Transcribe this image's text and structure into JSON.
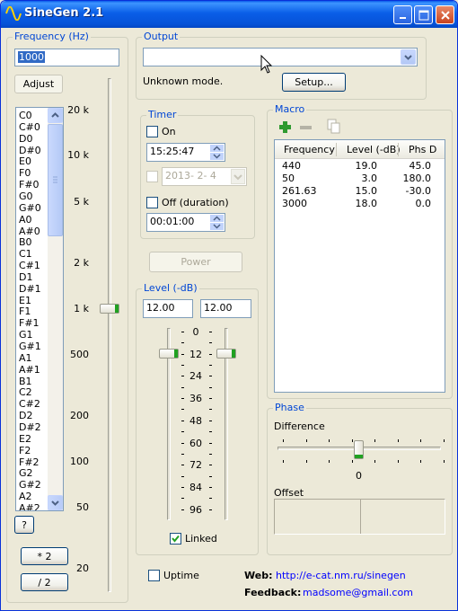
{
  "window": {
    "title": "SineGen 2.1"
  },
  "frequency": {
    "label": "Frequency (Hz)",
    "value": "1000",
    "adjust_label": "Adjust",
    "notes": [
      "C0",
      "C#0",
      "D0",
      "D#0",
      "E0",
      "F0",
      "F#0",
      "G0",
      "G#0",
      "A0",
      "A#0",
      "B0",
      "C1",
      "C#1",
      "D1",
      "D#1",
      "E1",
      "F1",
      "F#1",
      "G1",
      "G#1",
      "A1",
      "A#1",
      "B1",
      "C2",
      "C#2",
      "D2",
      "D#2",
      "E2",
      "F2",
      "F#2",
      "G2",
      "G#2",
      "A2",
      "A#2"
    ],
    "scale_labels": [
      "20 k",
      "10 k",
      "5 k",
      "2 k",
      "1 k",
      "500",
      "200",
      "100",
      "50",
      "20"
    ],
    "help_label": "?",
    "mul2_label": "* 2",
    "div2_label": "/ 2"
  },
  "output": {
    "label": "Output",
    "selected": "",
    "status": "Unknown mode.",
    "setup_label": "Setup..."
  },
  "timer": {
    "label": "Timer",
    "on_label": "On",
    "on_time": "15:25:47",
    "date": "2013- 2- 4",
    "off_label": "Off (duration)",
    "duration": "00:01:00"
  },
  "power": {
    "label": "Power"
  },
  "level": {
    "label": "Level (-dB)",
    "left_value": "12.00",
    "right_value": "12.00",
    "scale": [
      "0",
      "12",
      "24",
      "36",
      "48",
      "60",
      "72",
      "84",
      "96"
    ],
    "left_db": 12,
    "right_db": 12,
    "linked_label": "Linked",
    "linked": true
  },
  "macro": {
    "label": "Macro",
    "headers": [
      "Frequency",
      "Level (-dB)",
      "Phs D"
    ],
    "rows": [
      [
        "440",
        "19.0",
        "45.0"
      ],
      [
        "50",
        "3.0",
        "180.0"
      ],
      [
        "261.63",
        "15.0",
        "-30.0"
      ],
      [
        "3000",
        "18.0",
        "0.0"
      ]
    ]
  },
  "phase": {
    "label": "Phase",
    "difference_label": "Difference",
    "difference_value": "0",
    "offset_label": "Offset"
  },
  "footer": {
    "uptime_label": "Uptime",
    "web_label": "Web:",
    "web_link": "http://e-cat.nm.ru/sinegen",
    "feedback_label": "Feedback:",
    "feedback_link": "madsome@gmail.com"
  },
  "colors": {
    "titlebar": "#0a5ee8",
    "group_label": "#0046d5",
    "link": "#0000ff",
    "slider_grip": "#21a121"
  }
}
